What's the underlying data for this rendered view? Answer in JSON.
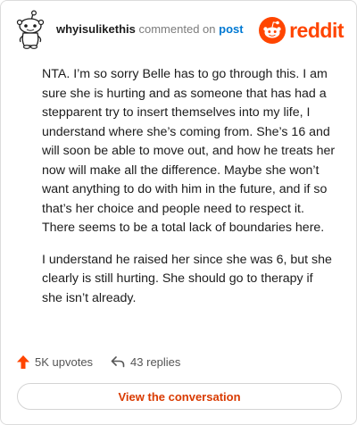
{
  "comment": {
    "username": "whyisulikethis",
    "action_text": "commented on",
    "post_link": "post",
    "paragraphs": [
      "NTA. I’m so sorry Belle has to go through this. I am sure she is hurting and as someone that has had a stepparent try to insert themselves into my life, I understand where she’s coming from. She’s 16 and will soon be able to move out, and how he treats her now will make all the difference. Maybe she won’t want anything to do with him in the future, and if so that’s her choice and people need to respect it. There seems to be a total lack of boundaries here.",
      "I understand he raised her since she was 6, but she clearly is still hurting. She should go to therapy if she isn’t already."
    ]
  },
  "brand": {
    "name": "reddit",
    "color": "#ff4500"
  },
  "actions": {
    "upvotes": "5K upvotes",
    "replies": "43 replies"
  },
  "cta": {
    "label": "View the conversation"
  },
  "colors": {
    "accent": "#ff4500",
    "link": "#0079d3",
    "cta_text": "#d93a00"
  }
}
